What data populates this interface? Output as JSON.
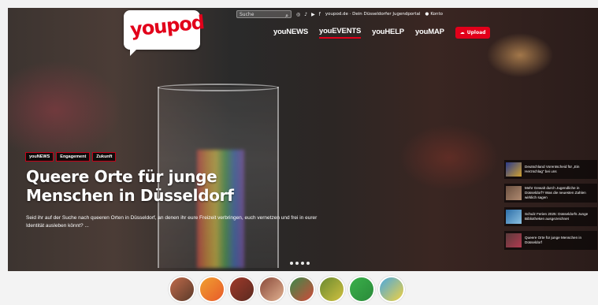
{
  "topbar": {
    "search_placeholder": "Suche",
    "tagline": "youpod.de · Dein Düsseldorfer Jugendportal",
    "account_label": "Konto",
    "social_icons": [
      "instagram-icon",
      "tiktok-icon",
      "youtube-icon",
      "facebook-icon"
    ]
  },
  "logo": {
    "text": "youpod"
  },
  "nav": {
    "items": [
      {
        "label": "youNEWS"
      },
      {
        "label": "youEVENTS"
      },
      {
        "label": "youHELP"
      },
      {
        "label": "youMAP"
      }
    ],
    "upload_label": "Upload"
  },
  "hero": {
    "tags": [
      "youNEWS",
      "Engagement",
      "Zukunft"
    ],
    "title": "Queere Orte für junge Menschen in Düsseldorf",
    "description": "Seid ihr auf der Suche nach queeren Orten in Düsseldorf, an denen ihr eure Freizeit verbringen, euch vernetzen und frei in eurer Identität ausleben könnt? ...",
    "slide_count": 4
  },
  "sidebar_posts": [
    {
      "text": "Deutschland Vorentscheid für „Ein Herzschlag“ bei uns"
    },
    {
      "text": "Mehr Gewalt durch Jugendliche in Düsseldorf? Was die neuesten Zahlen wirklich sagen"
    },
    {
      "text": "Schulz Ferien 2025: Düsseldorfs Junge Bibliotheken ausgezeichnet"
    },
    {
      "text": "Queere Orte für junge Menschen in Düsseldorf"
    }
  ],
  "colors": {
    "brand_red": "#e2001a"
  },
  "story_circles": 8
}
